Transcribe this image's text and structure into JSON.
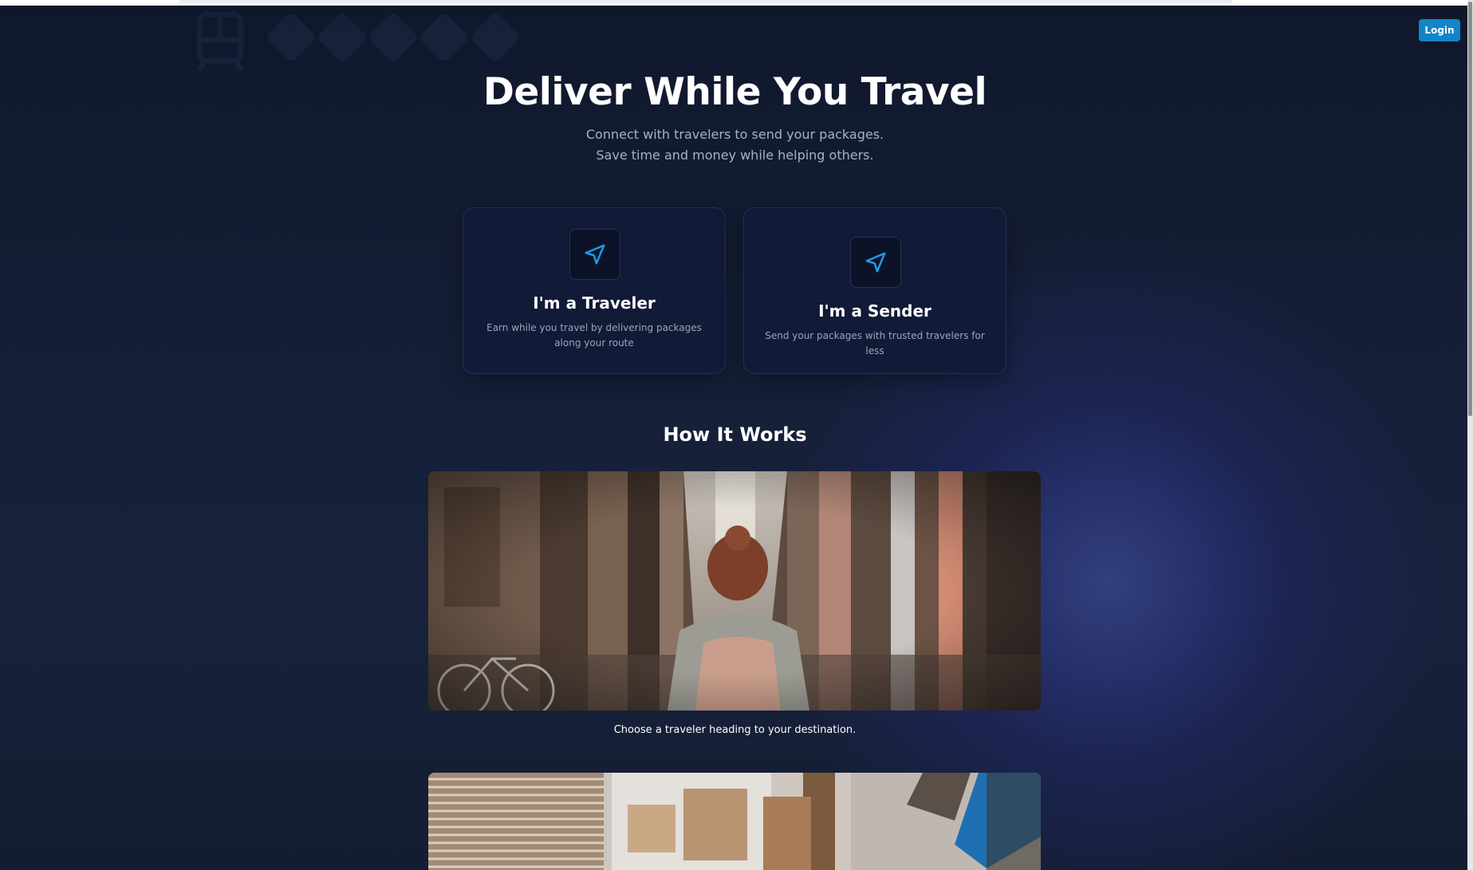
{
  "header": {
    "login_label": "Login",
    "accent_color": "#1284c7"
  },
  "hero": {
    "title": "Deliver While You Travel",
    "subtitle_line1": "Connect with travelers to send your packages.",
    "subtitle_line2": "Save time and money while helping others."
  },
  "cards": [
    {
      "title": "I'm a Traveler",
      "description": "Earn while you travel by delivering packages along your route",
      "icon": "send-arrow-icon"
    },
    {
      "title": "I'm a Sender",
      "description": "Send your packages with trusted travelers for less",
      "icon": "send-arrow-icon"
    }
  ],
  "how_it_works": {
    "title": "How It Works",
    "steps": [
      {
        "image": "traveler-in-alley-photo",
        "caption": "Choose a traveler heading to your destination."
      },
      {
        "image": "packing-boxes-photo"
      }
    ]
  },
  "decoration": {
    "icons": [
      "train-icon",
      "diamond-pattern"
    ]
  }
}
